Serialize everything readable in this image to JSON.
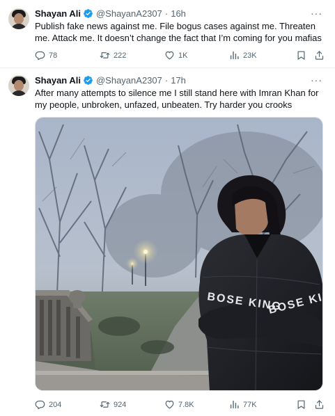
{
  "tweets": [
    {
      "author_name": "Shayan Ali",
      "handle": "@ShayanA2307",
      "separator": "·",
      "time": "16h",
      "text": "Publish fake news against me. File bogus cases against me. Threaten me. Attack me. It doesn’t change the fact that I’m coming for you mafias",
      "replies": "78",
      "reposts": "222",
      "likes": "1K",
      "views": "23K"
    },
    {
      "author_name": "Shayan Ali",
      "handle": "@ShayanA2307",
      "separator": "·",
      "time": "17h",
      "text": "After many attempts to silence me I still stand here with Imran Khan for my people, unbroken, unfazed, unbeaten. Try harder you crooks",
      "replies": "204",
      "reposts": "924",
      "likes": "7.8K",
      "views": "77K",
      "jacket_text": "BOSE KING"
    }
  ],
  "colors": {
    "text_primary": "#0f1419",
    "text_secondary": "#536471",
    "verified_blue": "#1d9bf0",
    "border": "#eff3f4"
  },
  "icons": [
    "avatar",
    "verified-badge-icon",
    "more-icon",
    "reply-icon",
    "repost-icon",
    "like-icon",
    "views-icon",
    "bookmark-icon",
    "share-icon"
  ]
}
